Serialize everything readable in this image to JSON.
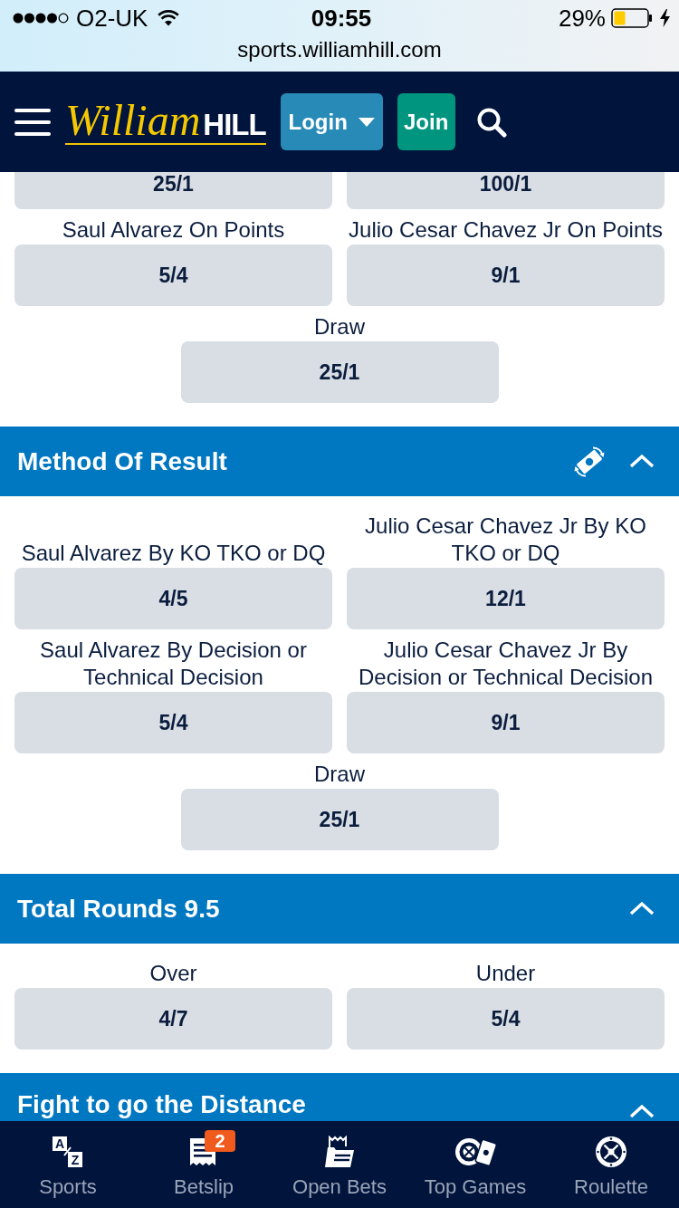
{
  "status_bar": {
    "carrier": "O2-UK",
    "time": "09:55",
    "battery": "29%",
    "url": "sports.williamhill.com"
  },
  "header": {
    "logo": {
      "script": "William",
      "block": "HILL"
    },
    "login": "Login",
    "join": "Join"
  },
  "markets": [
    {
      "rows": [
        [
          {
            "odds": "25/1"
          },
          {
            "odds": "100/1"
          }
        ],
        [
          {
            "label": "Saul Alvarez On Points",
            "odds": "5/4"
          },
          {
            "label": "Julio Cesar Chavez Jr On Points",
            "odds": "9/1"
          }
        ],
        [
          {
            "label": "Draw",
            "odds": "25/1"
          }
        ]
      ]
    },
    {
      "title": "Method Of Result",
      "expanded": true,
      "cash_out": true,
      "rows": [
        [
          {
            "label": "Saul Alvarez By KO TKO or DQ",
            "odds": "4/5"
          },
          {
            "label": "Julio Cesar Chavez Jr By KO TKO or DQ",
            "odds": "12/1"
          }
        ],
        [
          {
            "label": "Saul Alvarez By Decision or Technical Decision",
            "odds": "5/4"
          },
          {
            "label": "Julio Cesar Chavez Jr By Decision or Technical Decision",
            "odds": "9/1"
          }
        ],
        [
          {
            "label": "Draw",
            "odds": "25/1"
          }
        ]
      ]
    },
    {
      "title": "Total Rounds 9.5",
      "expanded": true,
      "cash_out": false,
      "rows": [
        [
          {
            "label": "Over",
            "odds": "4/7"
          },
          {
            "label": "Under",
            "odds": "5/4"
          }
        ]
      ]
    },
    {
      "title": "Fight to go the Distance",
      "expanded": true,
      "cash_out": false
    }
  ],
  "tab_bar": [
    {
      "label": "Sports",
      "selected": false,
      "icon_text": [
        "A",
        "Z"
      ]
    },
    {
      "label": "Betslip",
      "selected": false,
      "badge": "2"
    },
    {
      "label": "Open Bets",
      "selected": false
    },
    {
      "label": "Top Games",
      "selected": false
    },
    {
      "label": "Roulette",
      "selected": false
    }
  ]
}
